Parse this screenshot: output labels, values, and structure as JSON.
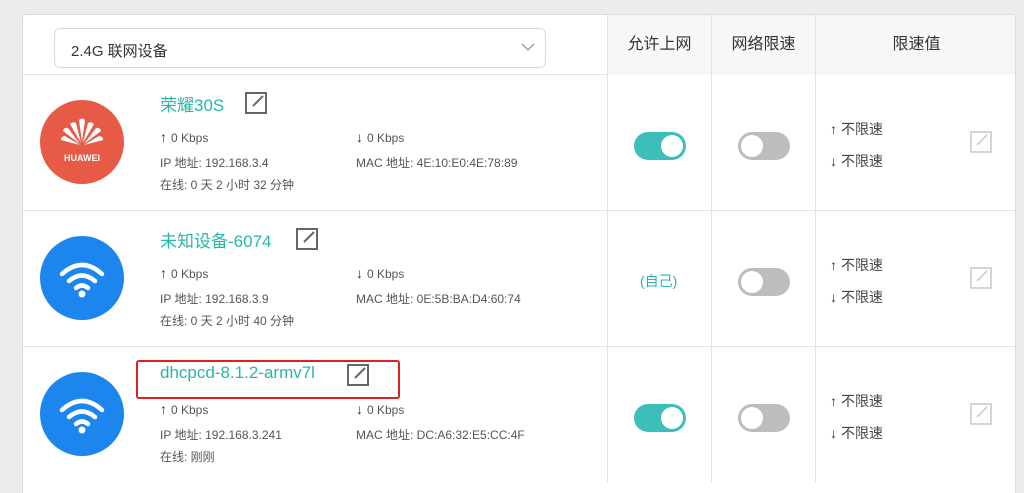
{
  "header": {
    "band_select": "2.4G 联网设备",
    "col_allow": "允许上网",
    "col_limit": "网络限速",
    "col_value": "限速值"
  },
  "devices": [
    {
      "name": "荣耀30S",
      "avatar_icon": "huawei-logo-icon",
      "avatar_text": "HUAWEI",
      "up": "0 Kbps",
      "down": "0 Kbps",
      "ip": "IP 地址: 192.168.3.4",
      "mac": "MAC 地址: 4E:10:E0:4E:78:89",
      "online": "在线: 0 天 2 小时 32 分钟",
      "allow": "on",
      "speed_limit": "off",
      "limit_up": "不限速",
      "limit_down": "不限速"
    },
    {
      "name": "未知设备-6074",
      "avatar_icon": "wifi-icon",
      "up": "0 Kbps",
      "down": "0 Kbps",
      "ip": "IP 地址: 192.168.3.9",
      "mac": "MAC 地址: 0E:5B:BA:D4:60:74",
      "online": "在线: 0 天 2 小时 40 分钟",
      "allow_text": "(自己)",
      "speed_limit": "off",
      "limit_up": "不限速",
      "limit_down": "不限速"
    },
    {
      "name": "dhcpcd-8.1.2-armv7l",
      "avatar_icon": "wifi-icon",
      "up": "0 Kbps",
      "down": "0 Kbps",
      "ip": "IP 地址: 192.168.3.241",
      "mac": "MAC 地址: DC:A6:32:E5:CC:4F",
      "online": "在线: 刚刚",
      "allow": "on",
      "speed_limit": "off",
      "limit_up": "不限速",
      "limit_down": "不限速"
    }
  ],
  "colors": {
    "accent": "#29b6a8",
    "toggle_on": "#3bbfb8",
    "toggle_off": "#bdbdbd",
    "huawei": "#e65a46",
    "wifi_blue": "#1c86ee",
    "highlight": "#e02020"
  }
}
